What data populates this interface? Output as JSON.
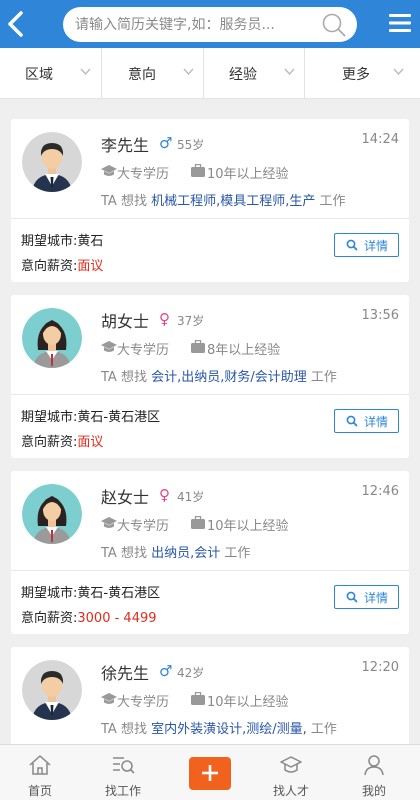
{
  "search": {
    "placeholder": "请输入简历关键字,如：服务员..."
  },
  "filters": [
    {
      "label": "区域"
    },
    {
      "label": "意向"
    },
    {
      "label": "经验"
    },
    {
      "label": "更多"
    }
  ],
  "candidates": [
    {
      "name": "李先生",
      "gender": "male",
      "gender_symbol": "♂",
      "age": "55岁",
      "time": "14:24",
      "education": "大专学历",
      "experience": "10年以上经验",
      "seek_prefix": "TA 想找",
      "seek_jobs": "机械工程师,模具工程师,生产",
      "seek_suffix": "工作",
      "city_label": "期望城市:",
      "city": "黄石",
      "salary_label": "意向薪资:",
      "salary": "面议",
      "detail_label": "详情"
    },
    {
      "name": "胡女士",
      "gender": "female",
      "gender_symbol": "♀",
      "age": "37岁",
      "time": "13:56",
      "education": "大专学历",
      "experience": "8年以上经验",
      "seek_prefix": "TA 想找",
      "seek_jobs": "会计,出纳员,财务/会计助理",
      "seek_suffix": "工作",
      "city_label": "期望城市:",
      "city": "黄石-黄石港区",
      "salary_label": "意向薪资:",
      "salary": "面议",
      "detail_label": "详情"
    },
    {
      "name": "赵女士",
      "gender": "female",
      "gender_symbol": "♀",
      "age": "41岁",
      "time": "12:46",
      "education": "大专学历",
      "experience": "10年以上经验",
      "seek_prefix": "TA 想找",
      "seek_jobs": "出纳员,会计",
      "seek_suffix": "工作",
      "city_label": "期望城市:",
      "city": "黄石-黄石港区",
      "salary_label": "意向薪资:",
      "salary": "3000 - 4499",
      "detail_label": "详情"
    },
    {
      "name": "徐先生",
      "gender": "male",
      "gender_symbol": "♂",
      "age": "42岁",
      "time": "12:20",
      "education": "大专学历",
      "experience": "10年以上经验",
      "seek_prefix": "TA 想找",
      "seek_jobs": "室内外装潢设计,测绘/测量,",
      "seek_suffix": "工作"
    }
  ],
  "tabs": [
    {
      "label": "首页",
      "icon": "home-icon"
    },
    {
      "label": "找工作",
      "icon": "find-job-icon"
    },
    {
      "label": "",
      "icon": "plus-icon"
    },
    {
      "label": "找人才",
      "icon": "find-talent-icon"
    },
    {
      "label": "我的",
      "icon": "user-icon"
    }
  ],
  "colors": {
    "brand": "#2f86d8",
    "male": "#2f86d8",
    "female": "#e0468a",
    "salary": "#e02c1c",
    "post": "#f0621d",
    "job_link": "#2a57a8"
  }
}
